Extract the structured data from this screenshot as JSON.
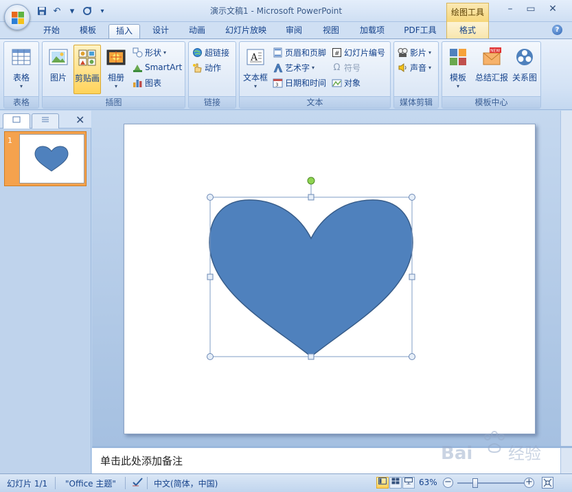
{
  "window": {
    "title": "演示文稿1 - Microsoft PowerPoint",
    "context_tab_title": "绘图工具",
    "minimize": "–",
    "maximize": "▭",
    "close": "✕"
  },
  "tabs": [
    "开始",
    "模板",
    "插入",
    "设计",
    "动画",
    "幻灯片放映",
    "审阅",
    "视图",
    "加载项",
    "PDF工具",
    "格式"
  ],
  "active_tab": "插入",
  "ribbon": {
    "groups": {
      "table": {
        "label": "表格",
        "button": "表格"
      },
      "illustrations": {
        "label": "插图",
        "picture": "图片",
        "clipart": "剪贴画",
        "album": "相册",
        "shapes": "形状",
        "smartart": "SmartArt",
        "chart": "图表"
      },
      "links": {
        "label": "链接",
        "hyperlink": "超链接",
        "action": "动作"
      },
      "text": {
        "label": "文本",
        "textbox": "文本框",
        "header_footer": "页眉和页脚",
        "wordart": "艺术字",
        "datetime": "日期和时间",
        "slide_number": "幻灯片编号",
        "symbol": "符号",
        "object": "对象"
      },
      "media": {
        "label": "媒体剪辑",
        "movie": "影片",
        "sound": "声音"
      },
      "template_center": {
        "label": "模板中心",
        "template": "模板",
        "summary": "总结汇报",
        "relation": "关系图",
        "new_badge": "NEW"
      }
    }
  },
  "left_panel": {
    "slide_number": "1",
    "close": "✕"
  },
  "notes": {
    "placeholder": "单击此处添加备注"
  },
  "status": {
    "slide": "幻灯片 1/1",
    "theme": "\"Office 主题\"",
    "language": "中文(简体，中国)",
    "zoom": "63%"
  },
  "colors": {
    "heart_fill": "#4f81bd",
    "heart_stroke": "#385d8a",
    "accent": "#15428b"
  },
  "watermark": "Baidu 经验"
}
